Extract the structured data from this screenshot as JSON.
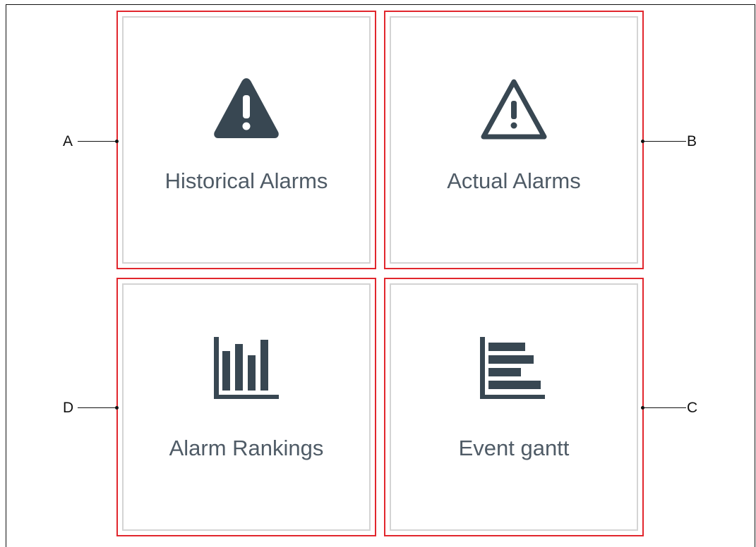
{
  "tiles": [
    {
      "id": "historical-alarms",
      "label": "Historical Alarms",
      "icon": "warning-filled-icon"
    },
    {
      "id": "actual-alarms",
      "label": "Actual Alarms",
      "icon": "warning-outline-icon"
    },
    {
      "id": "alarm-rankings",
      "label": "Alarm Rankings",
      "icon": "bar-chart-icon"
    },
    {
      "id": "event-gantt",
      "label": "Event gantt",
      "icon": "gantt-chart-icon"
    }
  ],
  "callouts": {
    "a": "A",
    "b": "B",
    "c": "C",
    "d": "D"
  },
  "colors": {
    "highlight_border": "#e1262d",
    "tile_border": "#d4d4d4",
    "icon": "#384752",
    "label": "#4f5b66"
  }
}
